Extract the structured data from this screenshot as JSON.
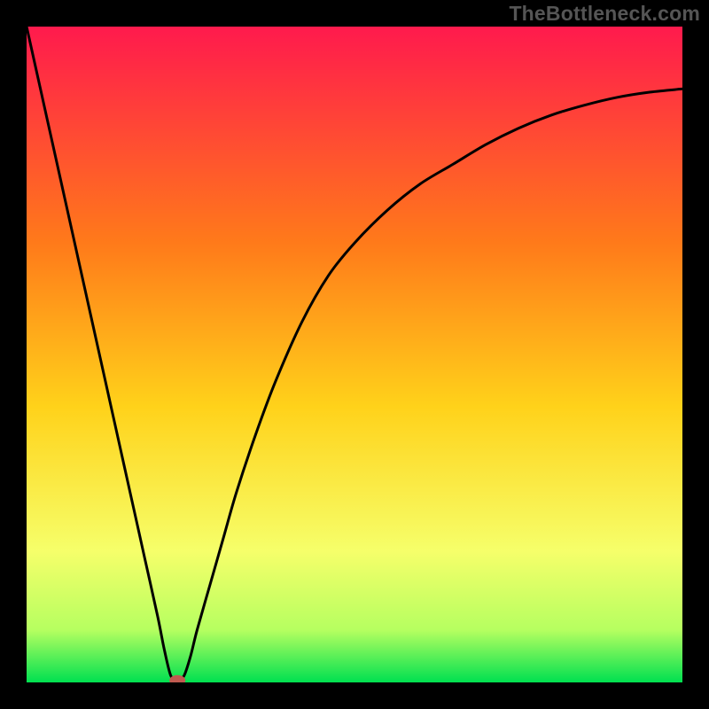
{
  "watermark": "TheBottleneck.com",
  "colors": {
    "background": "#000000",
    "curve": "#000000",
    "marker": "#c05a50",
    "gradient_top": "#ff1a4d",
    "gradient_upper_mid": "#ff7a1a",
    "gradient_mid": "#ffd21a",
    "gradient_low": "#f6ff6a",
    "gradient_very_low": "#b6ff60",
    "gradient_bottom": "#00e050"
  },
  "chart_data": {
    "type": "line",
    "title": "",
    "xlabel": "",
    "ylabel": "",
    "xlim": [
      0,
      100
    ],
    "ylim": [
      0,
      100
    ],
    "series": [
      {
        "name": "bottleneck-curve",
        "x": [
          0,
          2,
          4,
          6,
          8,
          10,
          12,
          14,
          16,
          18,
          20,
          21,
          22,
          23,
          24,
          25,
          26,
          28,
          30,
          32,
          35,
          38,
          42,
          46,
          50,
          55,
          60,
          65,
          70,
          75,
          80,
          85,
          90,
          95,
          100
        ],
        "y": [
          100,
          91,
          82,
          73,
          64,
          55,
          46,
          37,
          28,
          19,
          10,
          5,
          1,
          0.3,
          1,
          4,
          8,
          15,
          22,
          29,
          38,
          46,
          55,
          62,
          67,
          72,
          76,
          79,
          82,
          84.5,
          86.5,
          88,
          89.2,
          90,
          90.5
        ]
      }
    ],
    "marker": {
      "x": 23,
      "y": 0.3
    }
  }
}
